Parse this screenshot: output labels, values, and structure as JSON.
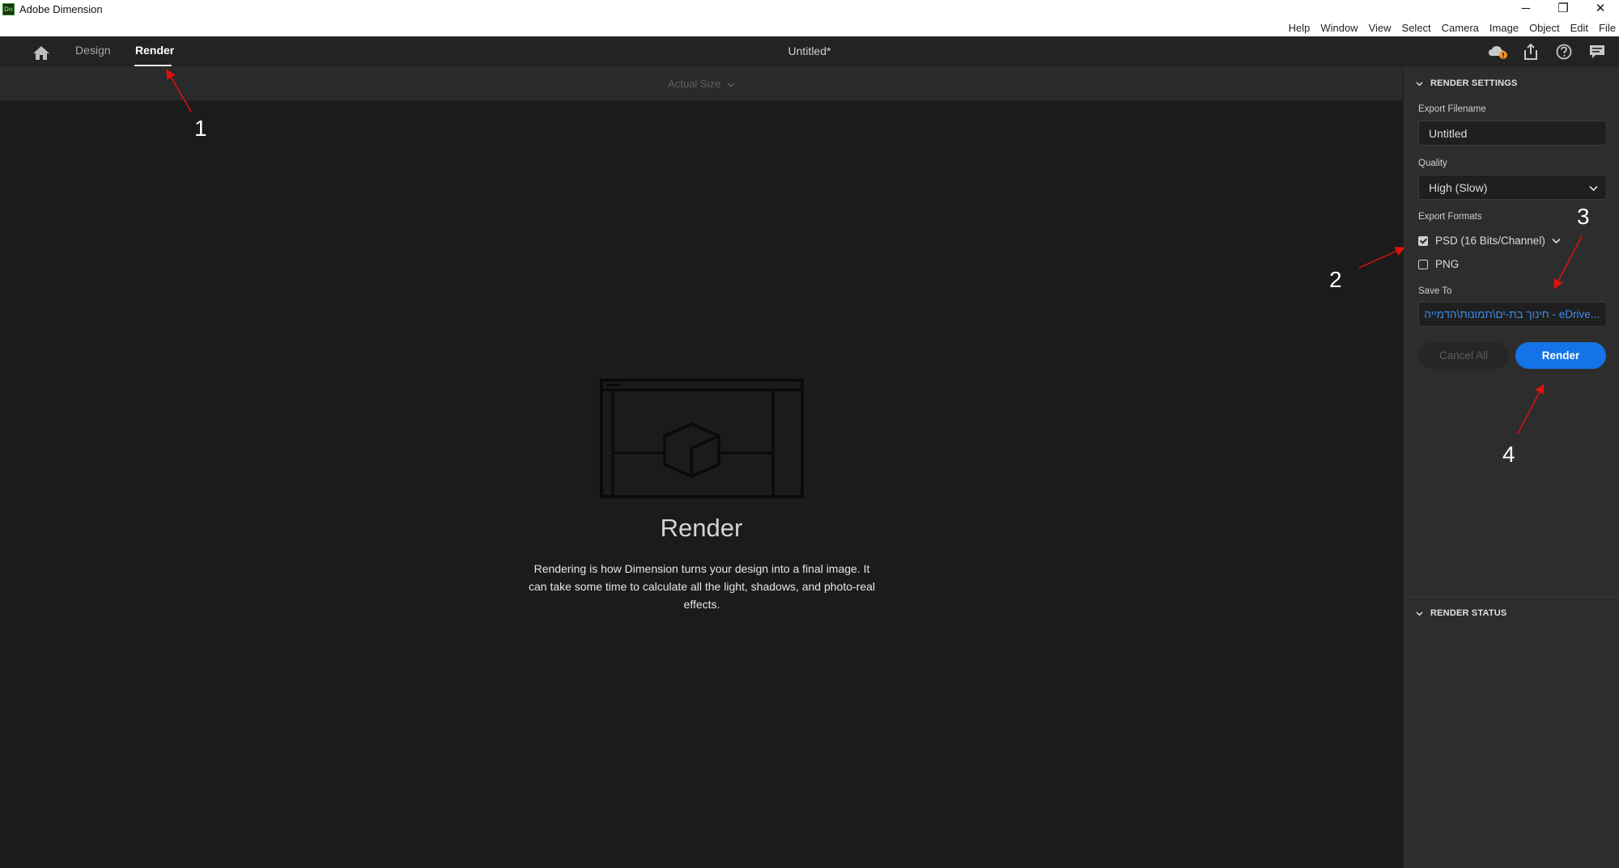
{
  "titlebar": {
    "logo_text": "Dn",
    "app_title": "Adobe Dimension",
    "minimize": "─",
    "restore": "❐",
    "close": "✕"
  },
  "menubar": [
    "Help",
    "Window",
    "View",
    "Select",
    "Camera",
    "Image",
    "Object",
    "Edit",
    "File"
  ],
  "header": {
    "tabs": [
      {
        "label": "Design",
        "active": false
      },
      {
        "label": "Render",
        "active": true
      }
    ],
    "document_title": "Untitled*",
    "icons": [
      "cloud-sync-warning-icon",
      "share-icon",
      "help-icon",
      "feedback-icon"
    ]
  },
  "viewbar": {
    "zoom_label": "Actual Size"
  },
  "canvas": {
    "heading": "Render",
    "description": "Rendering is how Dimension turns your design into a final image. It can take some time to calculate all the light, shadows, and photo-real effects."
  },
  "render_settings": {
    "section_title": "RENDER SETTINGS",
    "export_filename_label": "Export Filename",
    "export_filename_value": "Untitled",
    "quality_label": "Quality",
    "quality_value": "High (Slow)",
    "export_formats_label": "Export Formats",
    "formats": [
      {
        "label": "PSD (16 Bits/Channel)",
        "checked": true,
        "has_dropdown": true
      },
      {
        "label": "PNG",
        "checked": false,
        "has_dropdown": false
      }
    ],
    "save_to_label": "Save To",
    "save_to_value": "...eDrive - חינוך בת-ים\\תמונות\\הדמייה",
    "cancel_all_label": "Cancel All",
    "render_button_label": "Render"
  },
  "render_status": {
    "section_title": "RENDER STATUS"
  },
  "annotations": [
    "1",
    "2",
    "3",
    "4"
  ],
  "colors": {
    "accent": "#1473e6",
    "annotation_arrow": "#e01010",
    "save_path": "#3b8ef0"
  }
}
